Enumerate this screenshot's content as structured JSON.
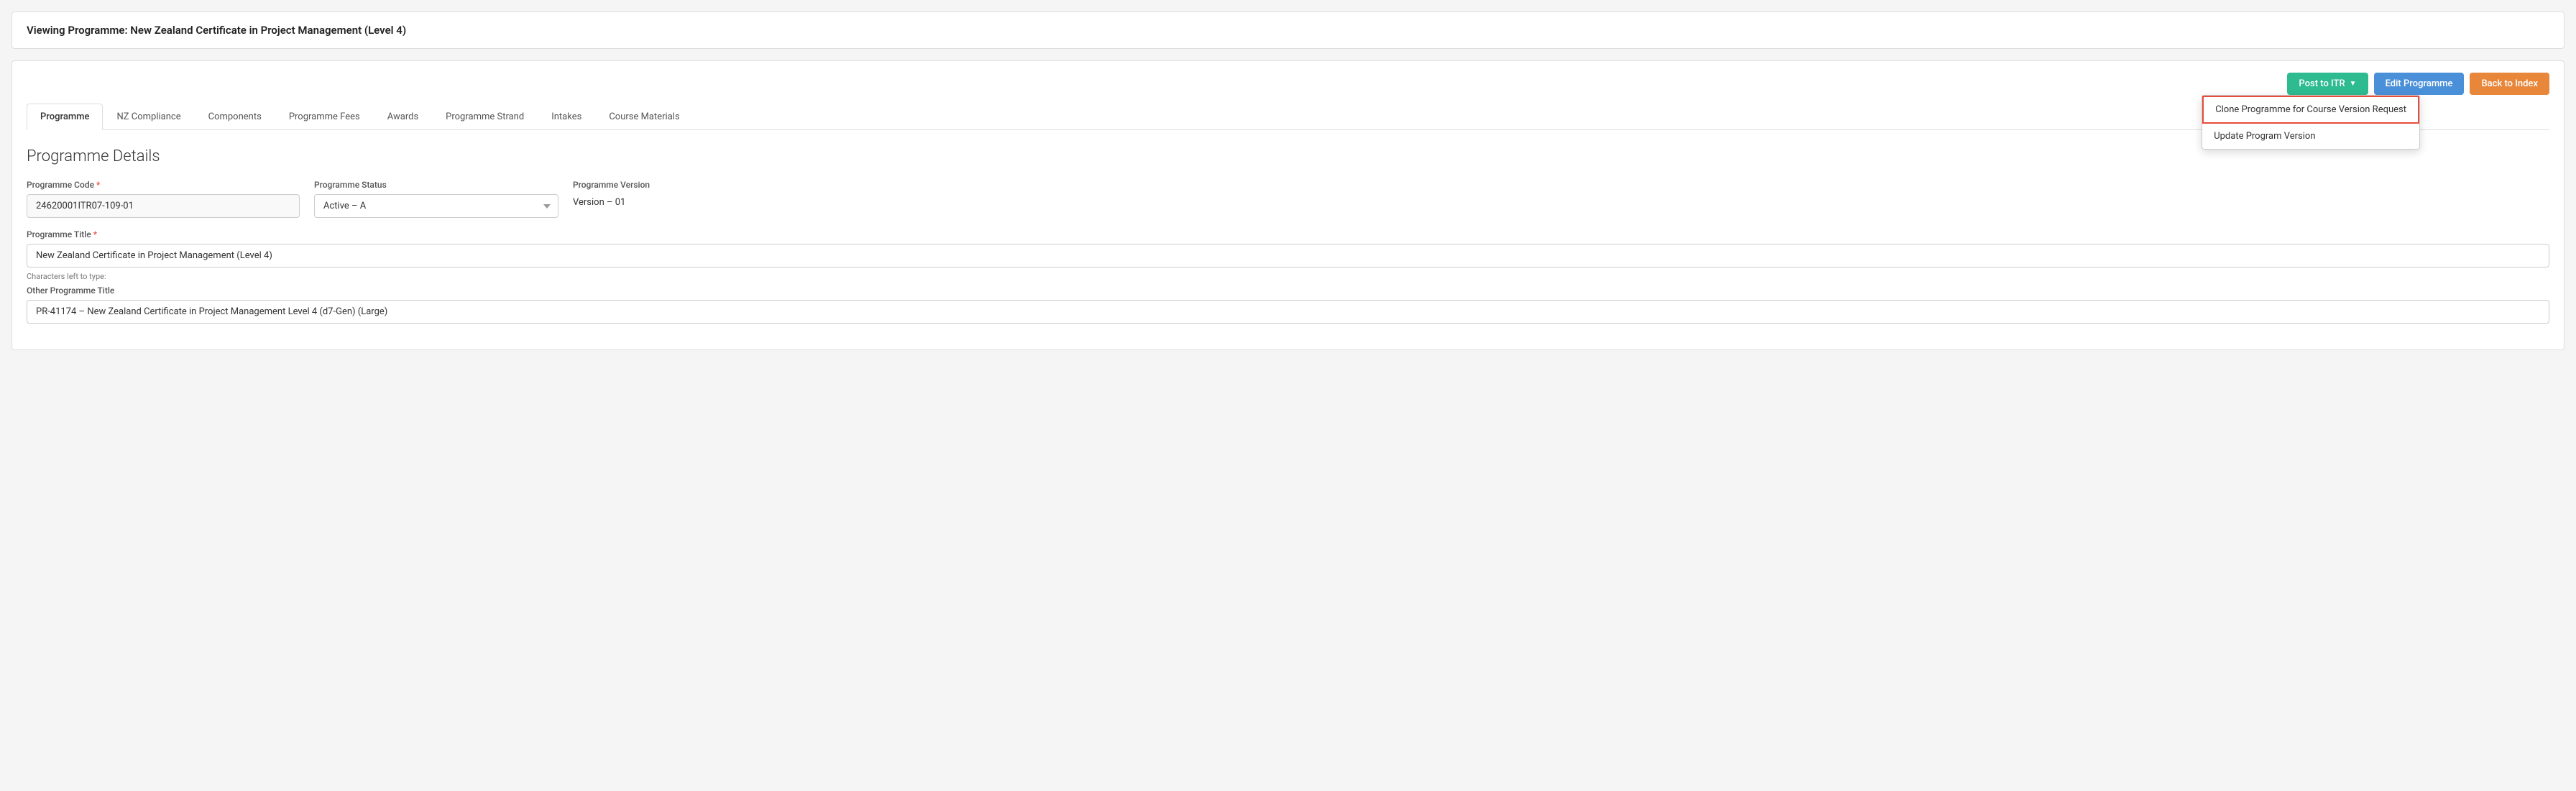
{
  "viewing_bar": {
    "title": "Viewing Programme: New Zealand Certificate in Project Management (Level 4)"
  },
  "toolbar": {
    "post_itr_label": "Post to ITR",
    "edit_programme_label": "Edit Programme",
    "back_to_index_label": "Back to Index"
  },
  "dropdown": {
    "items": [
      "Clone Programme for Course Version Request",
      "Update Program Version"
    ]
  },
  "tabs": [
    {
      "label": "Programme",
      "active": true
    },
    {
      "label": "NZ Compliance",
      "active": false
    },
    {
      "label": "Components",
      "active": false
    },
    {
      "label": "Programme Fees",
      "active": false
    },
    {
      "label": "Awards",
      "active": false
    },
    {
      "label": "Programme Strand",
      "active": false
    },
    {
      "label": "Intakes",
      "active": false
    },
    {
      "label": "Course Materials",
      "active": false
    }
  ],
  "section": {
    "title": "Programme Details"
  },
  "form": {
    "programme_code_label": "Programme Code",
    "programme_code_value": "24620001ITR07-109-01",
    "programme_status_label": "Programme Status",
    "programme_status_value": "Active – A",
    "programme_version_label": "Programme Version",
    "programme_version_value": "Version – 01",
    "programme_title_label": "Programme Title",
    "programme_title_value": "New Zealand Certificate in Project Management (Level 4)",
    "chars_left_label": "Characters left to type:",
    "other_title_label": "Other Programme Title",
    "other_title_value": "PR-41174 – New Zealand Certificate in Project Management Level 4 (d7-Gen) (Large)"
  },
  "colors": {
    "green": "#2dbb8f",
    "blue": "#4a90d9",
    "orange": "#e8863a",
    "red_border": "#e74c3c"
  }
}
